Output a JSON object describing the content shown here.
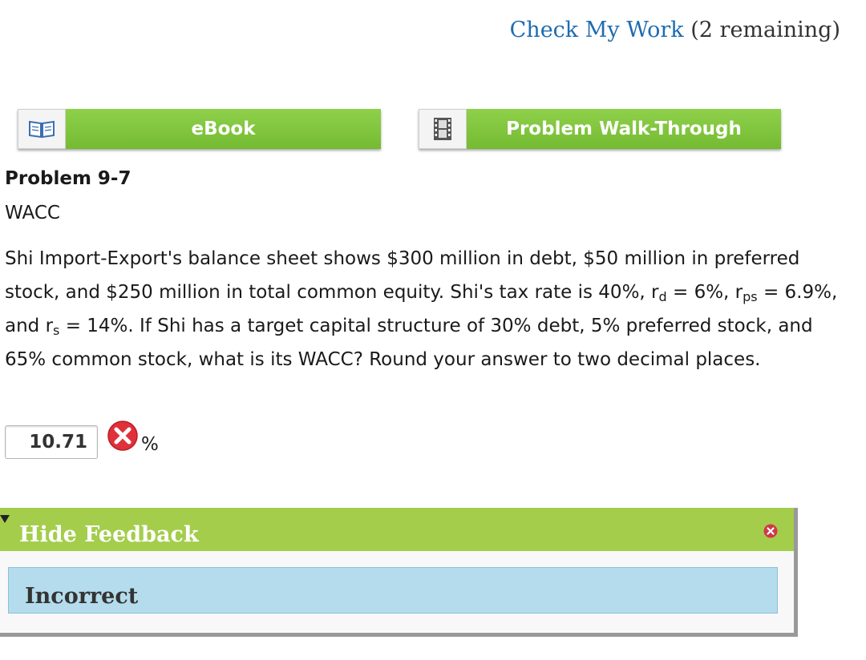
{
  "header": {
    "check_work_link": "Check My Work",
    "remaining": "(2 remaining)"
  },
  "resources": {
    "ebook_label": "eBook",
    "ebook_icon": "book-icon",
    "walkthrough_label": "Problem Walk-Through",
    "walkthrough_icon": "film-icon"
  },
  "problem": {
    "title": "Problem 9-7",
    "subtitle": "WACC",
    "text_1": "Shi Import-Export's balance sheet shows $300 million in debt, $50 million in preferred stock, and $250 million in total common equity. Shi's tax rate is 40%, r",
    "sub_d": "d",
    "text_2": " = 6%, r",
    "sub_ps": "ps",
    "text_3": " = 6.9%, and r",
    "sub_s": "s",
    "text_4": " = 14%. If Shi has a target capital structure of 30% debt, 5% preferred stock, and 65% common stock, what is its WACC? Round your answer to two decimal places."
  },
  "answer": {
    "value": "10.71",
    "unit": "%",
    "status_icon": "incorrect-x-icon",
    "status_color": "#e0303a"
  },
  "feedback": {
    "toggle_label": "Hide Feedback",
    "result": "Incorrect",
    "bar_color": "#a4cd4c",
    "result_bg": "#b4dcec"
  }
}
